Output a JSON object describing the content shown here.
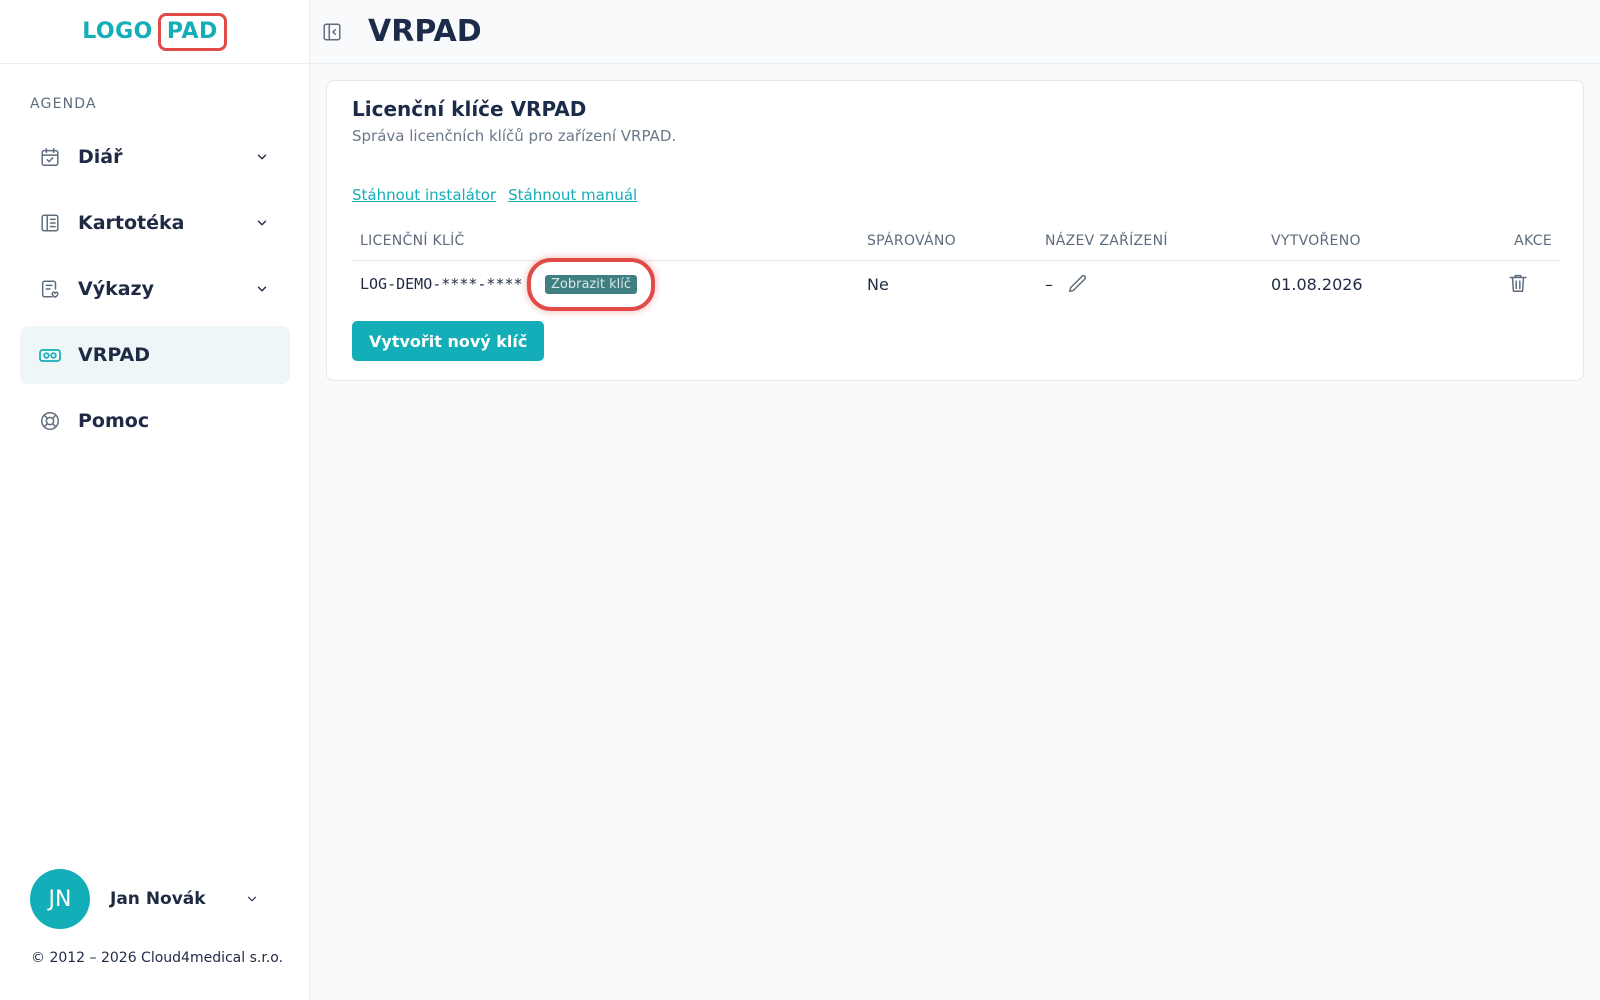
{
  "brand": {
    "logo_left": "LOGO",
    "logo_right": "PAD",
    "accent": "#14aeb8",
    "highlight": "#e04b47"
  },
  "sidebar": {
    "section_label": "AGENDA",
    "items": [
      {
        "label": "Diář",
        "icon": "calendar-check-icon",
        "has_chevron": true
      },
      {
        "label": "Kartotéka",
        "icon": "card-file-icon",
        "has_chevron": true
      },
      {
        "label": "Výkazy",
        "icon": "report-icon",
        "has_chevron": true
      },
      {
        "label": "VRPAD",
        "icon": "vr-headset-icon",
        "has_chevron": false,
        "active": true
      },
      {
        "label": "Pomoc",
        "icon": "lifebuoy-icon",
        "has_chevron": false
      }
    ],
    "user": {
      "initials": "JN",
      "name": "Jan Novák"
    },
    "copyright": "© 2012 – 2026 Cloud4medical s.r.o."
  },
  "header": {
    "title": "VRPAD"
  },
  "card": {
    "title": "Licenční klíče VRPAD",
    "subtitle": "Správa licenčních klíčů pro zařízení VRPAD.",
    "links": [
      "Stáhnout instalátor",
      "Stáhnout manuál"
    ],
    "columns": [
      "LICENČNÍ KLÍČ",
      "SPÁROVÁNO",
      "NÁZEV ZAŘÍZENÍ",
      "VYTVOŘENO",
      "AKCE"
    ],
    "rows": [
      {
        "key": "LOG-DEMO-****-****",
        "reveal_label": "Zobrazit klíč",
        "paired": "Ne",
        "device_name": "–",
        "created": "01.08.2026"
      }
    ],
    "create_button": "Vytvořit nový klíč"
  }
}
